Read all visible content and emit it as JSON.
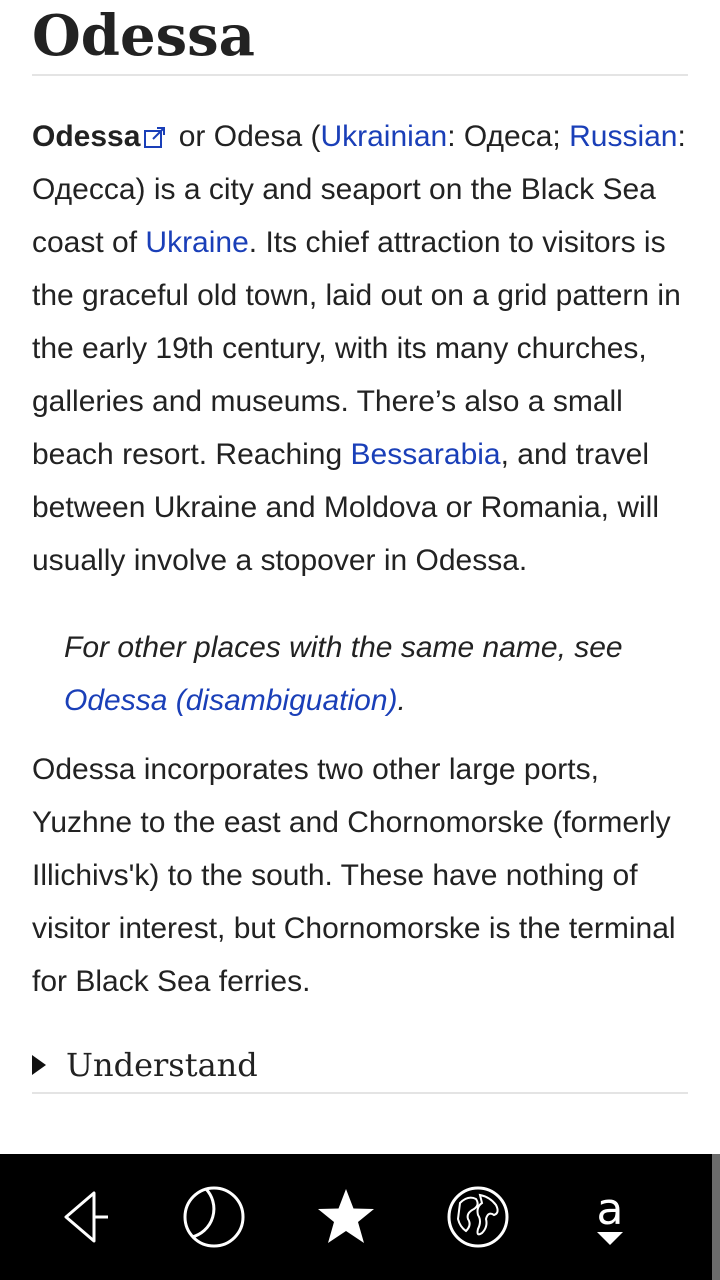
{
  "article": {
    "title": "Odessa",
    "p1": {
      "bold_name": "Odessa",
      "t1": " or Odesa (",
      "link_ukrainian": "Ukrainian",
      "t2": ": Одеса; ",
      "link_russian": "Russian",
      "t3": ": Одесса) is a city and seaport on the Black Sea coast of ",
      "link_ukraine": "Ukraine",
      "t4": ". Its chief attraction to visitors is the graceful old town, laid out on a grid pattern in the early 19th century, with its many churches, galleries and museums. There’s also a small beach resort. Reaching ",
      "link_bessarabia": "Bessarabia",
      "t5": ", and travel between Ukraine and Moldova or Romania, will usually involve a stopover in Odessa."
    },
    "hatnote": {
      "text": "For other places with the same name, see ",
      "link": "Odessa (disambiguation)",
      "end": "."
    },
    "p3": "Odessa incorporates two other large ports, Yuzhne to the east and Chornomorske (formerly Illichivs'k) to the south. These have nothing of visitor interest, but Chornomorske is the terminal for Black Sea ferries.",
    "section_understand": "Understand"
  },
  "toolbar": {
    "buttons": [
      {
        "name": "back-icon"
      },
      {
        "name": "night-mode-icon"
      },
      {
        "name": "bookmark-star-icon"
      },
      {
        "name": "globe-icon"
      },
      {
        "name": "font-size-icon",
        "glyph": "a"
      }
    ]
  },
  "colors": {
    "link": "#1a3fb8",
    "text": "#222222",
    "toolbar_bg": "#000000"
  }
}
